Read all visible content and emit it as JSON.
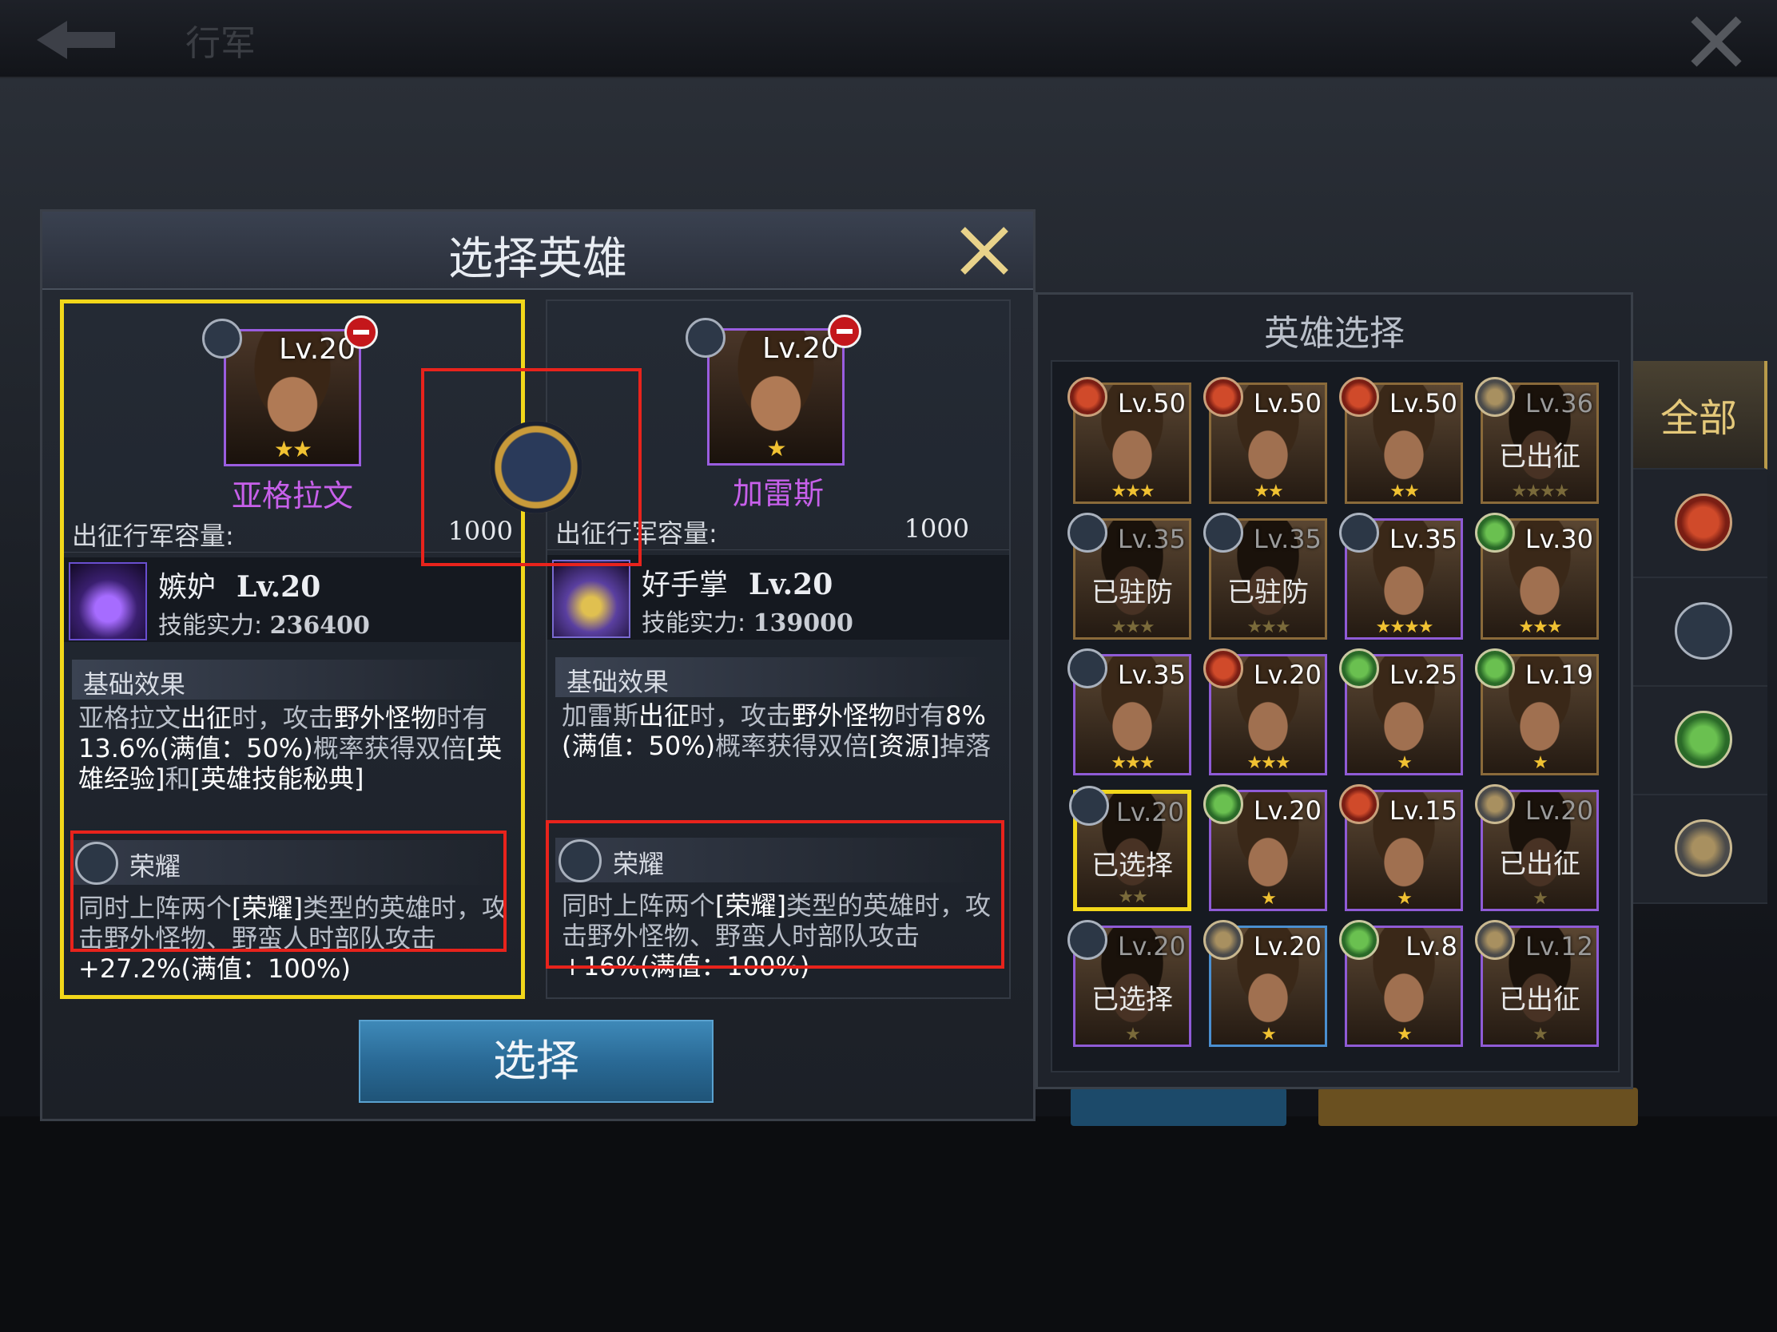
{
  "topbar": {
    "title": "行军"
  },
  "dialog": {
    "title": "选择英雄",
    "select_button": "选择",
    "heroes": [
      {
        "level": "Lv.20",
        "stars": "★★",
        "name": "亚格拉文",
        "capacity_label": "出征行军容量:",
        "capacity_value": "1000",
        "skill_name": "嫉妒",
        "skill_level": "Lv.20",
        "skill_power_label": "技能实力:",
        "skill_power_value": "236400",
        "base_effect_title": "基础效果",
        "base_effect_text": [
          "亚格拉文",
          "出征",
          "时，攻击",
          "野外怪物",
          "时有",
          "13.6%(满值：50%)",
          "概率获得双倍",
          "[英雄经验]",
          "和",
          "[英雄技能秘典]"
        ],
        "glory_title": "荣耀",
        "glory_text": [
          "同时上阵两个",
          "[荣耀]",
          "类型的英雄时，攻击野外怪物、野蛮人时部队攻击",
          "+27.2%(满值：100%)"
        ]
      },
      {
        "level": "Lv.20",
        "stars": "★",
        "name": "加雷斯",
        "capacity_label": "出征行军容量:",
        "capacity_value": "1000",
        "skill_name": "好手掌",
        "skill_level": "Lv.20",
        "skill_power_label": "技能实力:",
        "skill_power_value": "139000",
        "base_effect_title": "基础效果",
        "base_effect_text": [
          "加雷斯",
          "出征",
          "时，攻击",
          "野外怪物",
          "时有",
          "8%(满值：50%)",
          "概率获得双倍",
          "[资源]",
          "掉落"
        ],
        "glory_title": "荣耀",
        "glory_text": [
          "同时上阵两个",
          "[荣耀]",
          "类型的英雄时，攻击野外怪物、野蛮人时部队攻击",
          "+16%(满值：100%)"
        ]
      }
    ]
  },
  "selection_panel": {
    "title": "英雄选择",
    "cells": [
      {
        "level": "Lv.50",
        "stars": "★★★",
        "status": "",
        "type": "fire",
        "frame": "gold"
      },
      {
        "level": "Lv.50",
        "stars": "★★",
        "status": "",
        "type": "fire",
        "frame": "gold"
      },
      {
        "level": "Lv.50",
        "stars": "★★",
        "status": "",
        "type": "fire",
        "frame": "gold"
      },
      {
        "level": "Lv.36",
        "stars": "★★★★",
        "status": "已出征",
        "type": "hammer",
        "frame": "gold"
      },
      {
        "level": "Lv.35",
        "stars": "★★★",
        "status": "已驻防",
        "type": "sword",
        "frame": "gold"
      },
      {
        "level": "Lv.35",
        "stars": "★★★",
        "status": "已驻防",
        "type": "sword",
        "frame": "gold"
      },
      {
        "level": "Lv.35",
        "stars": "★★★★",
        "status": "",
        "type": "sword",
        "frame": "purple"
      },
      {
        "level": "Lv.30",
        "stars": "★★★",
        "status": "",
        "type": "leaf",
        "frame": "gold"
      },
      {
        "level": "Lv.35",
        "stars": "★★★",
        "status": "",
        "type": "sword",
        "frame": "purple"
      },
      {
        "level": "Lv.20",
        "stars": "★★★",
        "status": "",
        "type": "fire",
        "frame": "purple"
      },
      {
        "level": "Lv.25",
        "stars": "★",
        "status": "",
        "type": "leaf",
        "frame": "purple"
      },
      {
        "level": "Lv.19",
        "stars": "★",
        "status": "",
        "type": "leaf",
        "frame": "gold"
      },
      {
        "level": "Lv.20",
        "stars": "★★",
        "status": "已选择",
        "type": "sword",
        "frame": "yellow"
      },
      {
        "level": "Lv.20",
        "stars": "★",
        "status": "",
        "type": "leaf",
        "frame": "purple"
      },
      {
        "level": "Lv.15",
        "stars": "★",
        "status": "",
        "type": "fire",
        "frame": "purple"
      },
      {
        "level": "Lv.20",
        "stars": "★",
        "status": "已出征",
        "type": "hammer",
        "frame": "purple"
      },
      {
        "level": "Lv.20",
        "stars": "★",
        "status": "已选择",
        "type": "sword",
        "frame": "purple"
      },
      {
        "level": "Lv.20",
        "stars": "★",
        "status": "",
        "type": "hammer",
        "frame": "blue"
      },
      {
        "level": "Lv.8",
        "stars": "★",
        "status": "",
        "type": "leaf",
        "frame": "purple"
      },
      {
        "level": "Lv.12",
        "stars": "★",
        "status": "已出征",
        "type": "hammer",
        "frame": "purple"
      }
    ]
  },
  "filter_tabs": {
    "all_label": "全部",
    "icons": [
      "fire-icon",
      "sword-icon",
      "leaf-icon",
      "hammer-icon"
    ]
  },
  "colors": {
    "highlight_yellow": "#f2d71a",
    "annotation_red": "#e8231c",
    "hero_name_purple": "#c760ea"
  }
}
